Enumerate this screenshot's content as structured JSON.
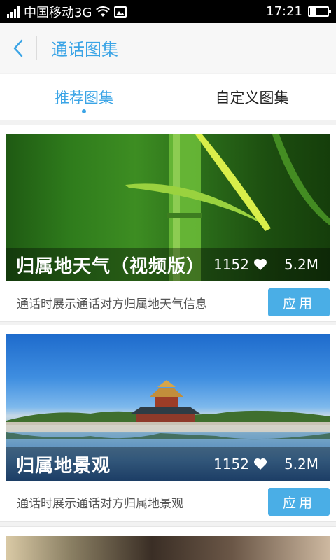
{
  "status_bar": {
    "carrier": "中国移动3G",
    "time": "17:21",
    "icons": [
      "signal-icon",
      "wifi-icon",
      "image-notification-icon",
      "battery-icon"
    ]
  },
  "header": {
    "back_icon": "chevron-left-icon",
    "title": "通话图集"
  },
  "tabs": [
    {
      "label": "推荐图集",
      "active": true
    },
    {
      "label": "自定义图集",
      "active": false
    }
  ],
  "cards": [
    {
      "title": "归属地天气（视频版）",
      "likes": "1152",
      "size": "5.2M",
      "description": "通话时展示通话对方归属地天气信息",
      "apply_label": "应用"
    },
    {
      "title": "归属地景观",
      "likes": "1152",
      "size": "5.2M",
      "description": "通话时展示通话对方归属地景观",
      "apply_label": "应用"
    }
  ],
  "colors": {
    "accent": "#3aa4e6",
    "button": "#4aaee6",
    "background": "#f2f2f2"
  }
}
